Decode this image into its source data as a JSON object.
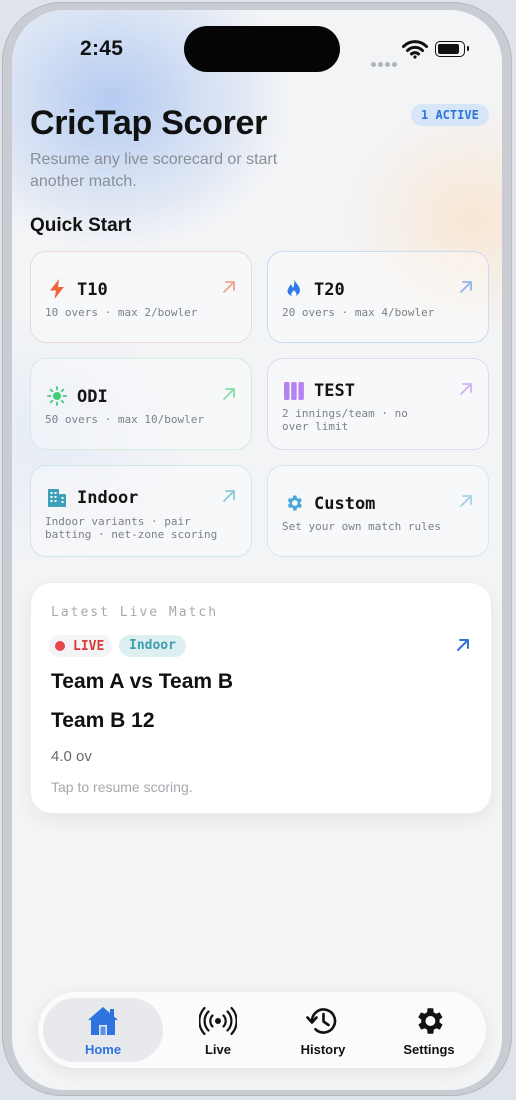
{
  "status_bar": {
    "time": "2:45"
  },
  "header": {
    "title": "CricTap Scorer",
    "active_badge": "1 ACTIVE",
    "subtitle": "Resume any live scorecard or start another match."
  },
  "quick_start": {
    "title": "Quick Start",
    "cards": [
      {
        "name": "T10",
        "desc": "10 overs · max 2/bowler",
        "icon": "bolt-icon",
        "accent": "#f0673a"
      },
      {
        "name": "T20",
        "desc": "20 overs · max 4/bowler",
        "icon": "flame-icon",
        "accent": "#2f7bea"
      },
      {
        "name": "ODI",
        "desc": "50 overs · max 10/bowler",
        "icon": "sun-icon",
        "accent": "#3ecf77"
      },
      {
        "name": "TEST",
        "desc": "2 innings/team · no over limit",
        "icon": "columns-icon",
        "accent": "#b583f0"
      },
      {
        "name": "Indoor",
        "desc": "Indoor variants · pair batting · net-zone scoring",
        "icon": "building-icon",
        "accent": "#3e9fb8"
      },
      {
        "name": "Custom",
        "desc": "Set your own match rules",
        "icon": "gear-icon",
        "accent": "#4aa6d8"
      }
    ]
  },
  "live_match": {
    "heading": "Latest Live Match",
    "live_label": "LIVE",
    "format": "Indoor",
    "teams": "Team A vs Team B",
    "score": "Team B 12",
    "overs": "4.0 ov",
    "hint": "Tap to resume scoring."
  },
  "tabs": [
    {
      "label": "Home",
      "icon": "house-icon",
      "active": true
    },
    {
      "label": "Live",
      "icon": "broadcast-icon",
      "active": false
    },
    {
      "label": "History",
      "icon": "history-icon",
      "active": false
    },
    {
      "label": "Settings",
      "icon": "gear-icon",
      "active": false
    }
  ]
}
